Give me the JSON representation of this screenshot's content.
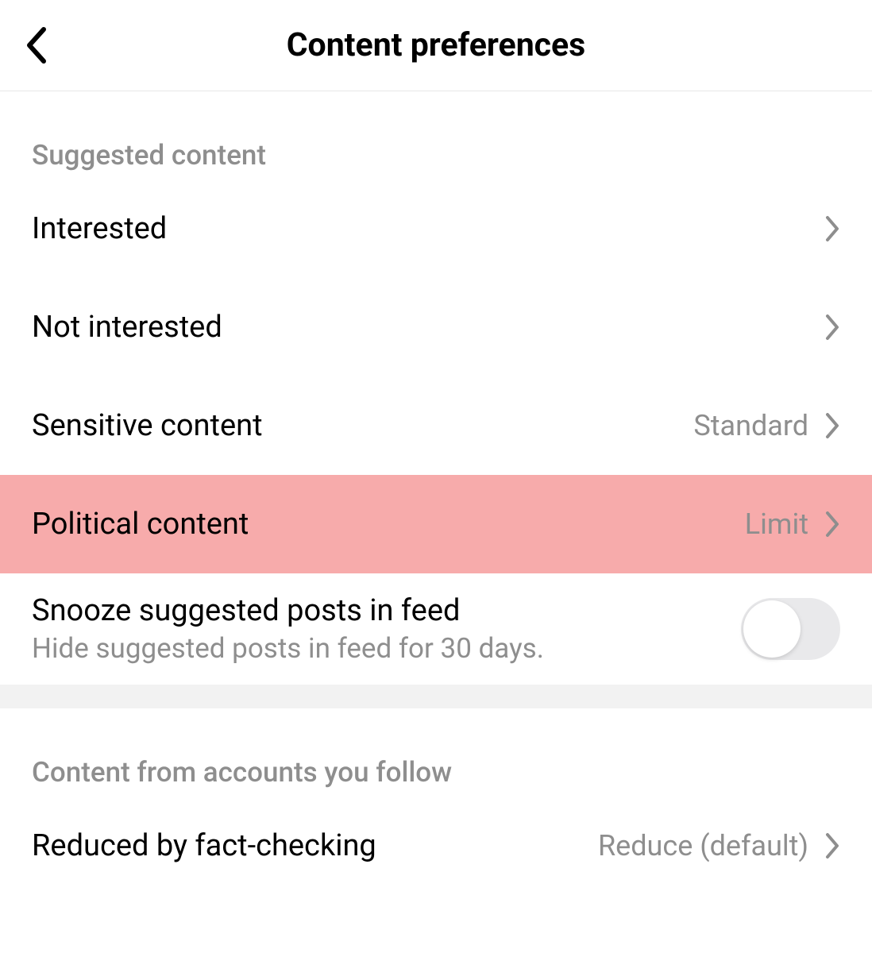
{
  "header": {
    "title": "Content preferences"
  },
  "section_suggested": {
    "header": "Suggested content",
    "items": {
      "interested": {
        "label": "Interested"
      },
      "not_interested": {
        "label": "Not interested"
      },
      "sensitive_content": {
        "label": "Sensitive content",
        "value": "Standard"
      },
      "political_content": {
        "label": "Political content",
        "value": "Limit"
      },
      "snooze": {
        "label": "Snooze suggested posts in feed",
        "subtitle": "Hide suggested posts in feed for 30 days."
      }
    }
  },
  "section_follow": {
    "header": "Content from accounts you follow",
    "items": {
      "reduced": {
        "label": "Reduced by fact-checking",
        "value": "Reduce (default)"
      }
    }
  }
}
